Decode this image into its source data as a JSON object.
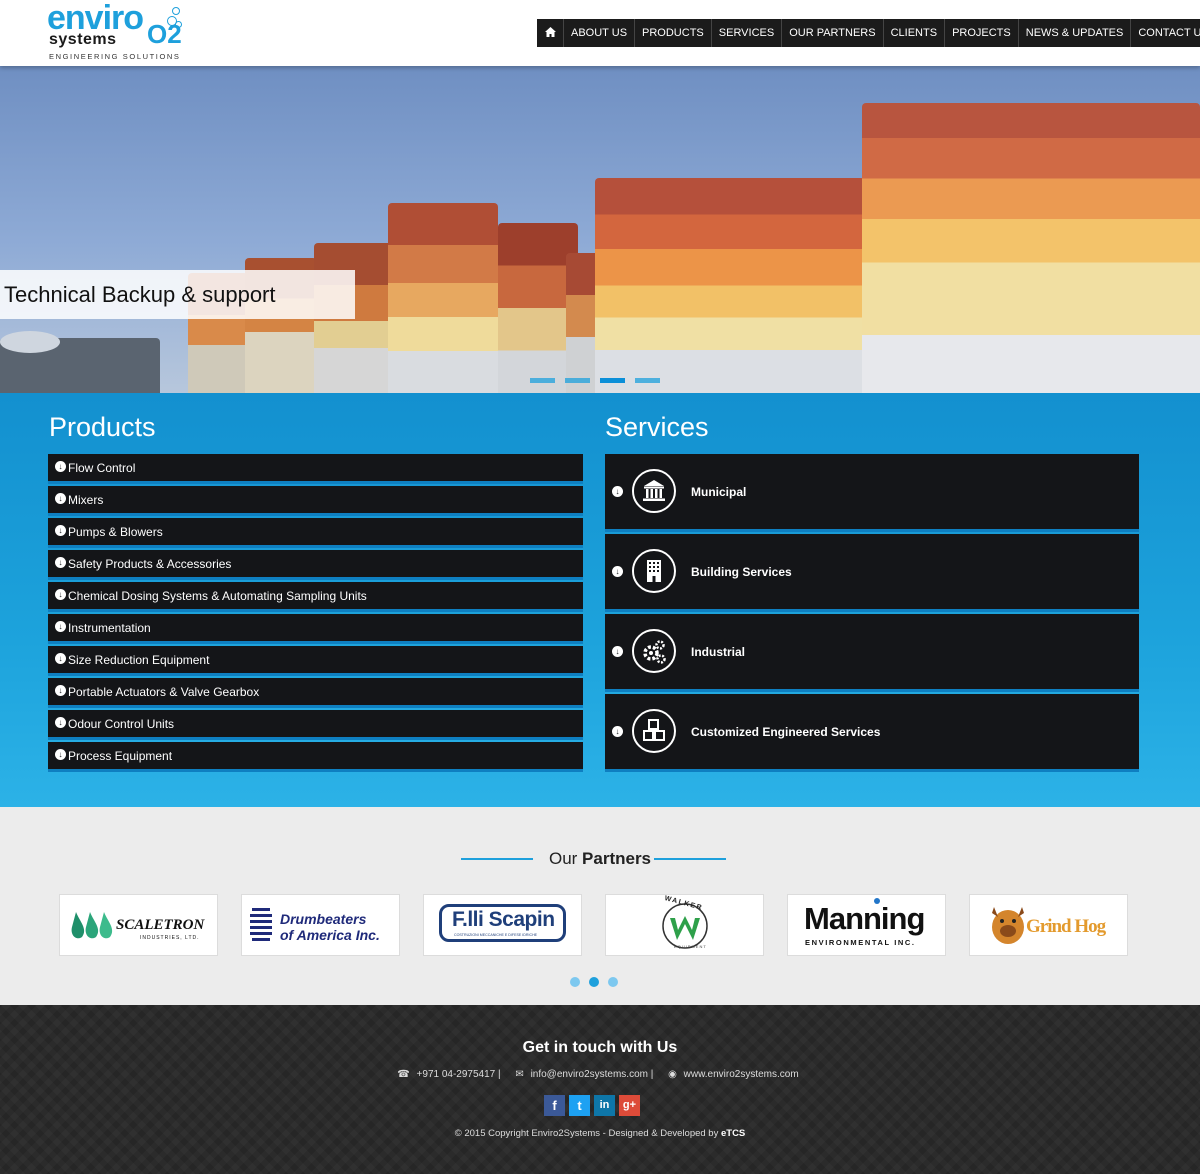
{
  "brand": {
    "logo_main": "enviro",
    "logo_second": "systems",
    "logo_o2": "O2",
    "logo_tagline": "ENGINEERING SOLUTIONS"
  },
  "nav": {
    "home_icon": "home-icon",
    "items": [
      "ABOUT US",
      "PRODUCTS",
      "SERVICES",
      "OUR PARTNERS",
      "CLIENTS",
      "PROJECTS",
      "NEWS & UPDATES",
      "CONTACT US"
    ]
  },
  "hero": {
    "caption": "Technical Backup & support",
    "slide_count": 4,
    "active_slide": 3
  },
  "products": {
    "title": "Products",
    "items": [
      "Flow Control",
      "Mixers",
      "Pumps & Blowers",
      "Safety Products & Accessories",
      "Chemical Dosing Systems & Automating Sampling Units",
      "Instrumentation",
      "Size Reduction Equipment",
      "Portable Actuators & Valve Gearbox",
      "Odour Control Units",
      "Process Equipment"
    ]
  },
  "services": {
    "title": "Services",
    "items": [
      {
        "label": "Municipal",
        "icon": "building-columns-icon"
      },
      {
        "label": "Building Services",
        "icon": "office-building-icon"
      },
      {
        "label": "Industrial",
        "icon": "gears-icon"
      },
      {
        "label": "Customized Engineered Services",
        "icon": "cubes-icon"
      }
    ]
  },
  "partners": {
    "title_light": "Our ",
    "title_bold": "Partners",
    "logos": [
      {
        "name": "SCALETRON",
        "sub": "INDUSTRIES, LTD."
      },
      {
        "name": "Drumbeaters",
        "sub": "of America Inc."
      },
      {
        "name": "F.lli Scapin",
        "sub": "COSTRUZIONI MECCANICHE E DIFESE IDRICHE"
      },
      {
        "name": "WALKER",
        "sub": "EQUIPMENT"
      },
      {
        "name": "Manning",
        "sub": "ENVIRONMENTAL INC."
      },
      {
        "name": "Grind Hog",
        "sub": ""
      }
    ],
    "page_count": 3,
    "active_page": 2
  },
  "footer": {
    "title": "Get in touch with Us",
    "phone": "+971 04-2975417 |",
    "email": "info@enviro2systems.com |",
    "website": "www.enviro2systems.com",
    "social": [
      "f",
      "t",
      "in",
      "g+"
    ],
    "copyright": "© 2015 Copyright Enviro2Systems - Designed & Developed by ",
    "developer": "eTCS"
  },
  "colors": {
    "accent": "#1ea0dc",
    "dark": "#141518",
    "facebook": "#3b5998",
    "twitter": "#1da1f2",
    "linkedin": "#0e76a8",
    "googleplus": "#dd4b39"
  }
}
